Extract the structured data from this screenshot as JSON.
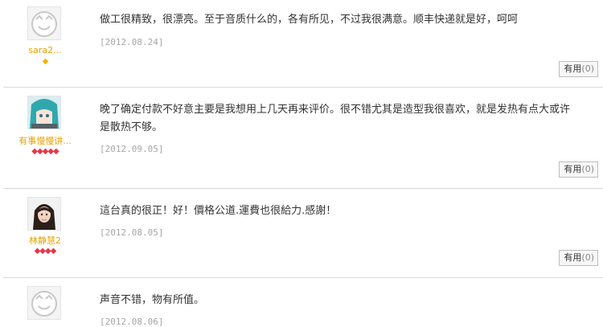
{
  "reviews": [
    {
      "user": "sara2...",
      "avatar": "default-face-icon",
      "badge_icons": "gem-icon",
      "badges": "◆",
      "content": "做工很精致，很漂亮。至于音质什么的，各有所见，不过我很满意。顺丰快递就是好，呵呵",
      "date": "[2012.08.24]",
      "useful_label": "有用",
      "useful_count": "(0)"
    },
    {
      "user": "有事慢慢讲...",
      "avatar": "anime-avatar-icon",
      "badge_icons": "gem-icon",
      "badges": "◆◆◆◆◆",
      "content": "晚了确定付款不好意主要是我想用上几天再来评价。很不错尤其是造型我很喜欢，就是发热有点大或许是散热不够。",
      "date": "[2012.09.05]",
      "useful_label": "有用",
      "useful_count": "(0)"
    },
    {
      "user": "林静慧2",
      "avatar": "photo-avatar-icon",
      "badge_icons": "gem-icon",
      "badges": "◆◆◆◆",
      "content": "這台真的很正！好！價格公道.運費也很給力.感謝！",
      "date": "[2012.08.05]",
      "useful_label": "有用",
      "useful_count": "(0)"
    },
    {
      "user": "",
      "avatar": "default-face-icon",
      "content": "声音不错，物有所值。",
      "date": "[2012.08.06]"
    }
  ],
  "colors": {
    "username": "#e8a200",
    "gem_red": "#e4384b",
    "gem_yellow": "#f2b600",
    "date": "#a6a6a6"
  }
}
